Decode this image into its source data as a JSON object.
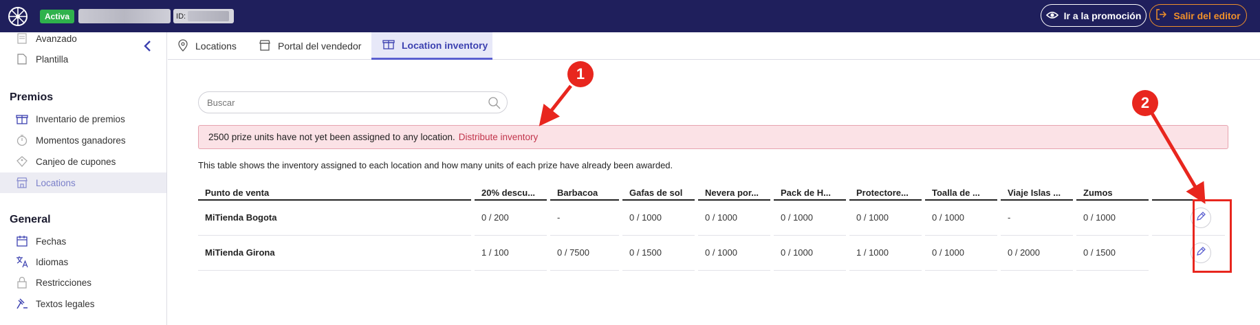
{
  "topbar": {
    "status_badge": "Activa",
    "id_label": "ID:",
    "promo_button": "Ir a la promoción",
    "exit_button": "Salir del editor",
    "colors": {
      "bar": "#1f1f5c",
      "active": "#2fb24c",
      "exit": "#f0902a"
    }
  },
  "sidebar": {
    "top_items": [
      {
        "label": "Avanzado",
        "icon": "document-icon"
      },
      {
        "label": "Plantilla",
        "icon": "page-icon"
      }
    ],
    "premios_heading": "Premios",
    "premios_items": [
      {
        "label": "Inventario de premios",
        "icon": "gift-icon"
      },
      {
        "label": "Momentos ganadores",
        "icon": "stopwatch-icon"
      },
      {
        "label": "Canjeo de cupones",
        "icon": "coupon-icon"
      },
      {
        "label": "Locations",
        "icon": "store-icon",
        "active": true
      }
    ],
    "general_heading": "General",
    "general_items": [
      {
        "label": "Fechas",
        "icon": "calendar-icon"
      },
      {
        "label": "Idiomas",
        "icon": "translate-icon"
      },
      {
        "label": "Restricciones",
        "icon": "lock-icon"
      },
      {
        "label": "Textos legales",
        "icon": "gavel-icon"
      }
    ]
  },
  "tabs": [
    {
      "label": "Locations",
      "icon": "location-pin-icon"
    },
    {
      "label": "Portal del vendedor",
      "icon": "store-icon"
    },
    {
      "label": "Location inventory",
      "icon": "gift-icon",
      "active": true
    }
  ],
  "search": {
    "placeholder": "Buscar"
  },
  "alert": {
    "message": "2500 prize units have not yet been assigned to any location.",
    "link": "Distribute inventory"
  },
  "info_text": "This table shows the inventory assigned to each location and how many units of each prize have already been awarded.",
  "table": {
    "headers": [
      "Punto de venta",
      "20% descu...",
      "Barbacoa",
      "Gafas de sol",
      "Nevera por...",
      "Pack de H...",
      "Protectore...",
      "Toalla de ...",
      "Viaje Islas ...",
      "Zumos"
    ],
    "rows": [
      {
        "name": "MiTienda Bogota",
        "cells": [
          "0 / 200",
          "-",
          "0 / 1000",
          "0 / 1000",
          "0 / 1000",
          "0 / 1000",
          "0 / 1000",
          "-",
          "0 / 1000"
        ]
      },
      {
        "name": "MiTienda Girona",
        "cells": [
          "1 / 100",
          "0 / 7500",
          "0 / 1500",
          "0 / 1000",
          "0 / 1000",
          "1 / 1000",
          "0 / 1000",
          "0 / 2000",
          "0 / 1500"
        ]
      }
    ]
  },
  "annotations": {
    "first": "1",
    "second": "2",
    "color": "#e8261e"
  }
}
